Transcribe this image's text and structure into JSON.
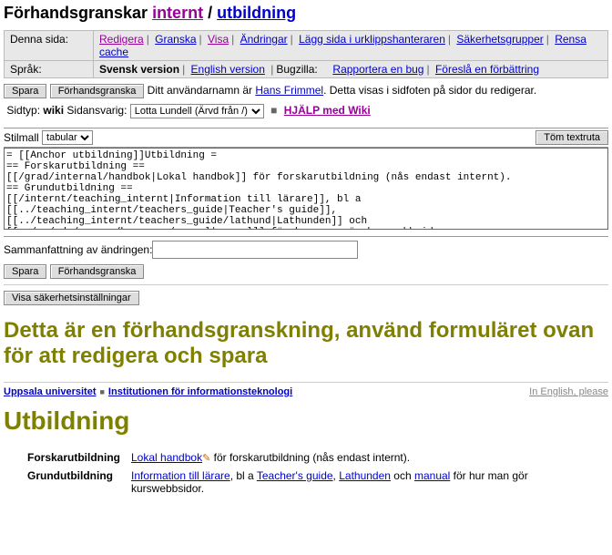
{
  "breadcrumb": {
    "prefix": "Förhandsgranskar",
    "link1": "internt",
    "sep": "/",
    "link2": "utbildning"
  },
  "meta": {
    "row1_label": "Denna sida:",
    "row1_links": {
      "edit": "Redigera",
      "review": "Granska",
      "show": "Visa",
      "changes": "Ändringar",
      "clipboard": "Lägg sida i urklippshanteraren",
      "security": "Säkerhetsgrupper",
      "clear": "Rensa cache"
    },
    "row2_label": "Språk:",
    "lang_sv": "Svensk version",
    "lang_en": "English version",
    "bugzilla_label": "Bugzilla:",
    "bug_report": "Rapportera en bug",
    "bug_suggest": "Föreslå en förbättring"
  },
  "buttons": {
    "save": "Spara",
    "preview": "Förhandsgranska",
    "clear_textarea": "Töm textruta",
    "show_security": "Visa säkerhetsinställningar"
  },
  "username_line": {
    "prefix": "Ditt användarnamn är ",
    "user": "Hans Frimmel",
    "suffix": ". Detta visas i sidfoten på sidor du redigerar."
  },
  "pagetype": {
    "label": "Sidtyp:",
    "value": "wiki",
    "resp_label": "Sidansvarig:",
    "resp_value": "Lotta Lundell (Ärvd från /)",
    "help": "HJÄLP med Wiki"
  },
  "stylesheet": {
    "label": "Stilmall",
    "value": "tabular"
  },
  "wikitext": "= [[Anchor utbildning]]Utbildning =\n== Forskarutbildning ==\n[[/grad/internal/handbok|Lokal handbok]] för forskarutbildning (nås endast internt).\n== Grundutbildning ==\n[[/internt/teaching_internt|Information till lärare]], bl a [[../teaching_internt/teachers_guide|Teacher's guide]], [[../teaching_internt/teachers_guide/lathund|Lathunden]] och [[../../edu/course/homepage/manual|manual]] för hur man gör kurswebbsidor.",
  "summary_label": "Sammanfattning av ändringen:",
  "summary_value": "",
  "preview_heading": "Detta är en förhandsgranskning, använd formuläret ovan för att redigera och spara",
  "crumbs2": {
    "uni": "Uppsala universitet",
    "dept": "Institutionen för informationsteknologi",
    "english": "In English, please"
  },
  "content": {
    "title": "Utbildning",
    "rows": [
      {
        "term": "Forskarutbildning",
        "link1": "Lokal handbok",
        "tail": " för forskarutbildning (nås endast internt)."
      },
      {
        "term": "Grundutbildning",
        "link1": "Information till lärare",
        "mid1": ", bl a ",
        "link2": "Teacher's guide",
        "mid2": ", ",
        "link3": "Lathunden",
        "mid3": " och ",
        "link4": "manual",
        "tail": " för hur man gör kurswebbsidor."
      }
    ]
  }
}
